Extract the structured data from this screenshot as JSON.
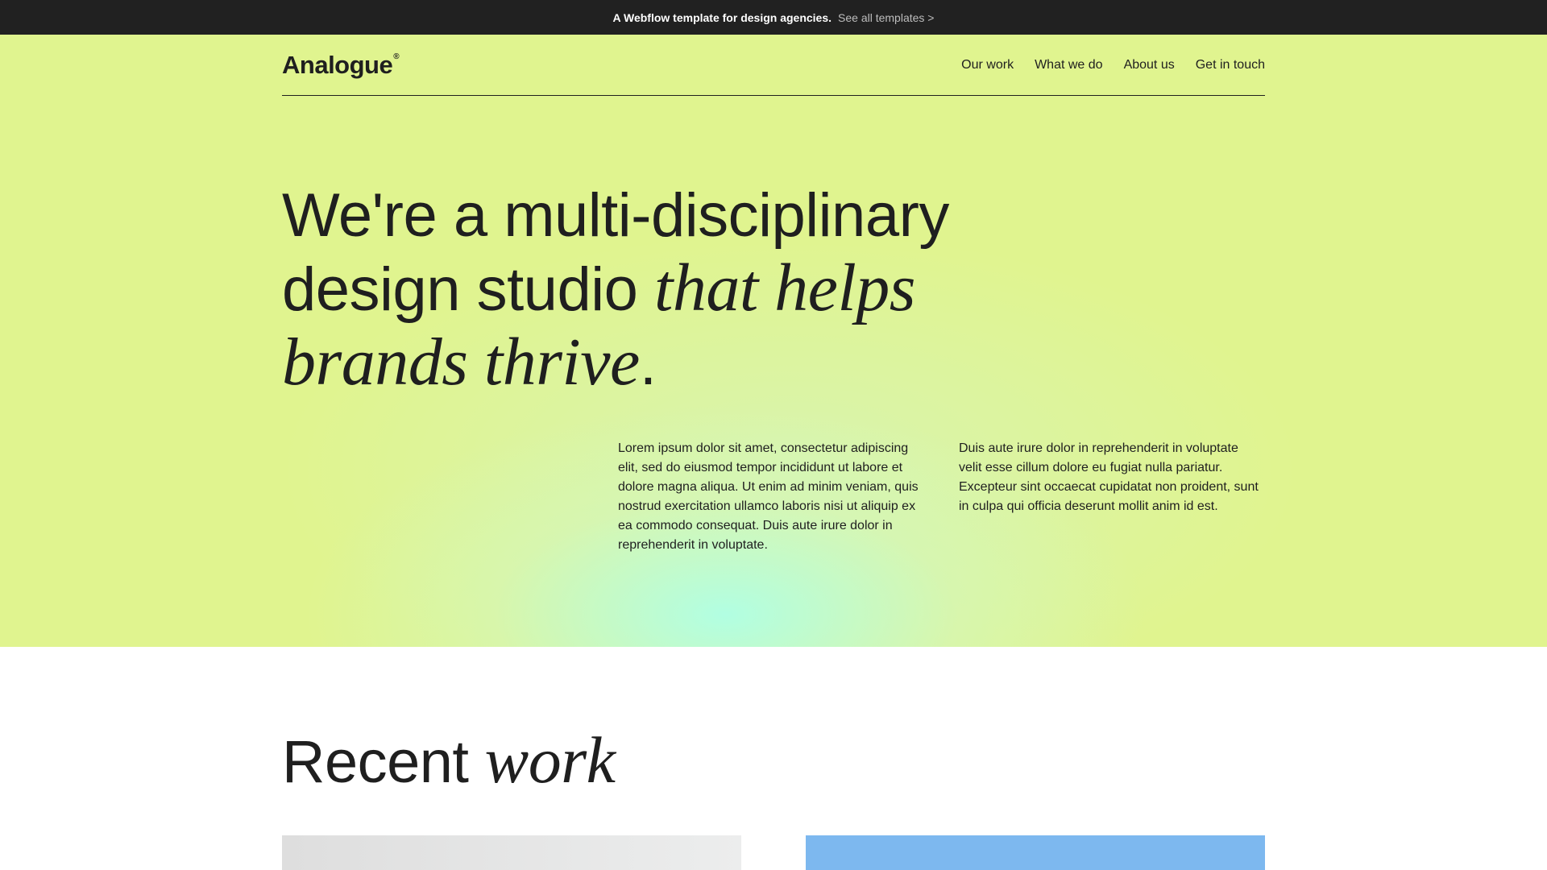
{
  "topbar": {
    "promo": "A Webflow template for design agencies.",
    "cta": "See all templates >"
  },
  "nav": {
    "logo": "Analogue",
    "logo_mark": "®",
    "links": [
      "Our work",
      "What we do",
      "About us",
      "Get in touch"
    ]
  },
  "hero": {
    "headline_plain": "We're a multi-disciplinary design studio",
    "headline_italic": "that helps brands thrive",
    "headline_end": ".",
    "paragraph_1": "Lorem ipsum dolor sit amet, consectetur adipiscing elit, sed do eiusmod tempor incididunt ut labore et dolore magna aliqua. Ut enim ad minim veniam, quis nostrud exercitation ullamco laboris nisi ut aliquip ex ea commodo consequat. Duis aute irure dolor in reprehenderit in voluptate.",
    "paragraph_2": "Duis aute irure dolor in reprehenderit in voluptate velit esse cillum dolore eu fugiat nulla pariatur. Excepteur sint occaecat cupidatat non proident, sunt in culpa qui officia deserunt mollit anim id est."
  },
  "recent": {
    "title_plain": "Recent",
    "title_italic": "work"
  },
  "colors": {
    "hero_bg": "#e0f48f",
    "topbar_bg": "#212121",
    "card_blue": "#7db8ef"
  }
}
